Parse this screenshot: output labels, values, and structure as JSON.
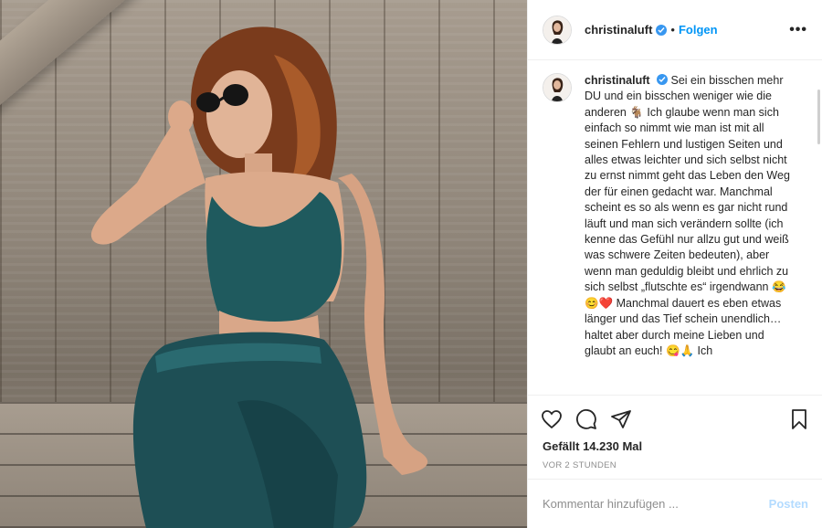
{
  "header": {
    "username": "christinaluft",
    "separator": "•",
    "follow_label": "Folgen",
    "more_label": "•••"
  },
  "caption": {
    "username": "christinaluft",
    "text": "Sei ein bisschen mehr DU und ein bisschen weniger wie die anderen 🐐 Ich glaube wenn man sich einfach so nimmt wie man ist mit all seinen Fehlern und lustigen Seiten und alles etwas leichter und sich selbst nicht zu ernst nimmt geht das Leben den Weg der für einen gedacht war. Manchmal scheint es so als wenn es gar nicht rund läuft und man sich verändern sollte (ich kenne das Gefühl nur allzu gut und weiß was schwere Zeiten bedeuten), aber wenn man geduldig bleibt und ehrlich zu sich selbst „flutschte es“ irgendwann 😂😊❤️ Manchmal dauert es eben etwas länger und das Tief schein unendlich…haltet aber durch meine Lieben und glaubt an euch! 😋🙏 Ich"
  },
  "actions": {
    "like_icon": "heart-icon",
    "comment_icon": "comment-icon",
    "share_icon": "paper-plane-icon",
    "save_icon": "bookmark-icon"
  },
  "likes": "Gefällt 14.230 Mal",
  "timestamp": "VOR 2 STUNDEN",
  "comment_box": {
    "placeholder": "Kommentar hinzufügen ...",
    "post_label": "Posten"
  },
  "colors": {
    "accent": "#0095f6",
    "verified": "#3897f0",
    "post_disabled": "#b3dbff",
    "outfit": "#1f5a5e"
  }
}
